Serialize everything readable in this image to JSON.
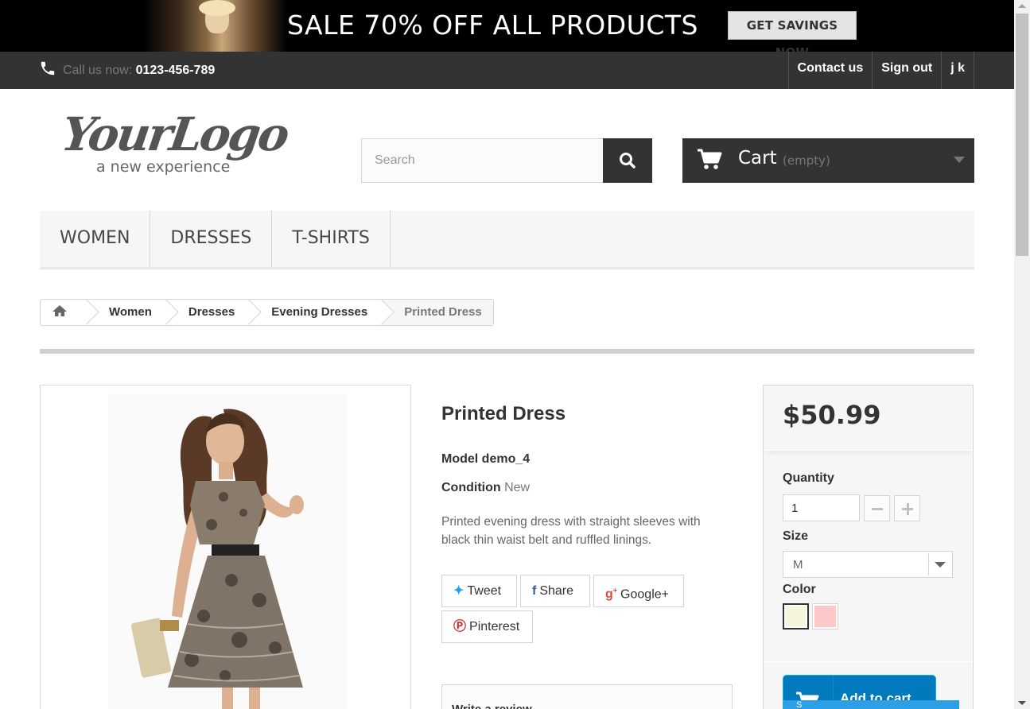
{
  "banner": {
    "headline": "SALE 70% OFF ALL PRODUCTS",
    "cta": "GET SAVINGS NOW"
  },
  "topnav": {
    "call_label": "Call us now:",
    "phone": "0123-456-789",
    "links": [
      "Contact us",
      "Sign out",
      "j k"
    ]
  },
  "logo": {
    "script": "YourLogo",
    "tagline": "a new experience"
  },
  "search": {
    "placeholder": "Search"
  },
  "cart": {
    "label": "Cart",
    "status": "(empty)"
  },
  "menu": {
    "items": [
      "WOMEN",
      "DRESSES",
      "T-SHIRTS"
    ]
  },
  "breadcrumb": {
    "home_icon": "home-icon",
    "items": [
      "Women",
      "Dresses",
      "Evening Dresses",
      "Printed Dress"
    ]
  },
  "product": {
    "name": "Printed Dress",
    "model_label": "Model",
    "model_value": "demo_4",
    "condition_label": "Condition",
    "condition_value": "New",
    "description": "Printed evening dress with straight sleeves with black thin waist belt and ruffled linings.",
    "social": {
      "tweet": "Tweet",
      "share": "Share",
      "google": "Google+",
      "pinterest": "Pinterest"
    },
    "review_label": "Write a review"
  },
  "buy": {
    "price": "$50.99",
    "quantity_label": "Quantity",
    "quantity_value": "1",
    "size_label": "Size",
    "size_value": "M",
    "color_label": "Color",
    "colors": [
      "#f5f5dc",
      "#fcc8c8"
    ],
    "add_to_cart": "Add to cart",
    "tooltip_text": "S"
  },
  "colors": {
    "dark_bar": "#333333",
    "accent_blue": "#0079bd"
  }
}
